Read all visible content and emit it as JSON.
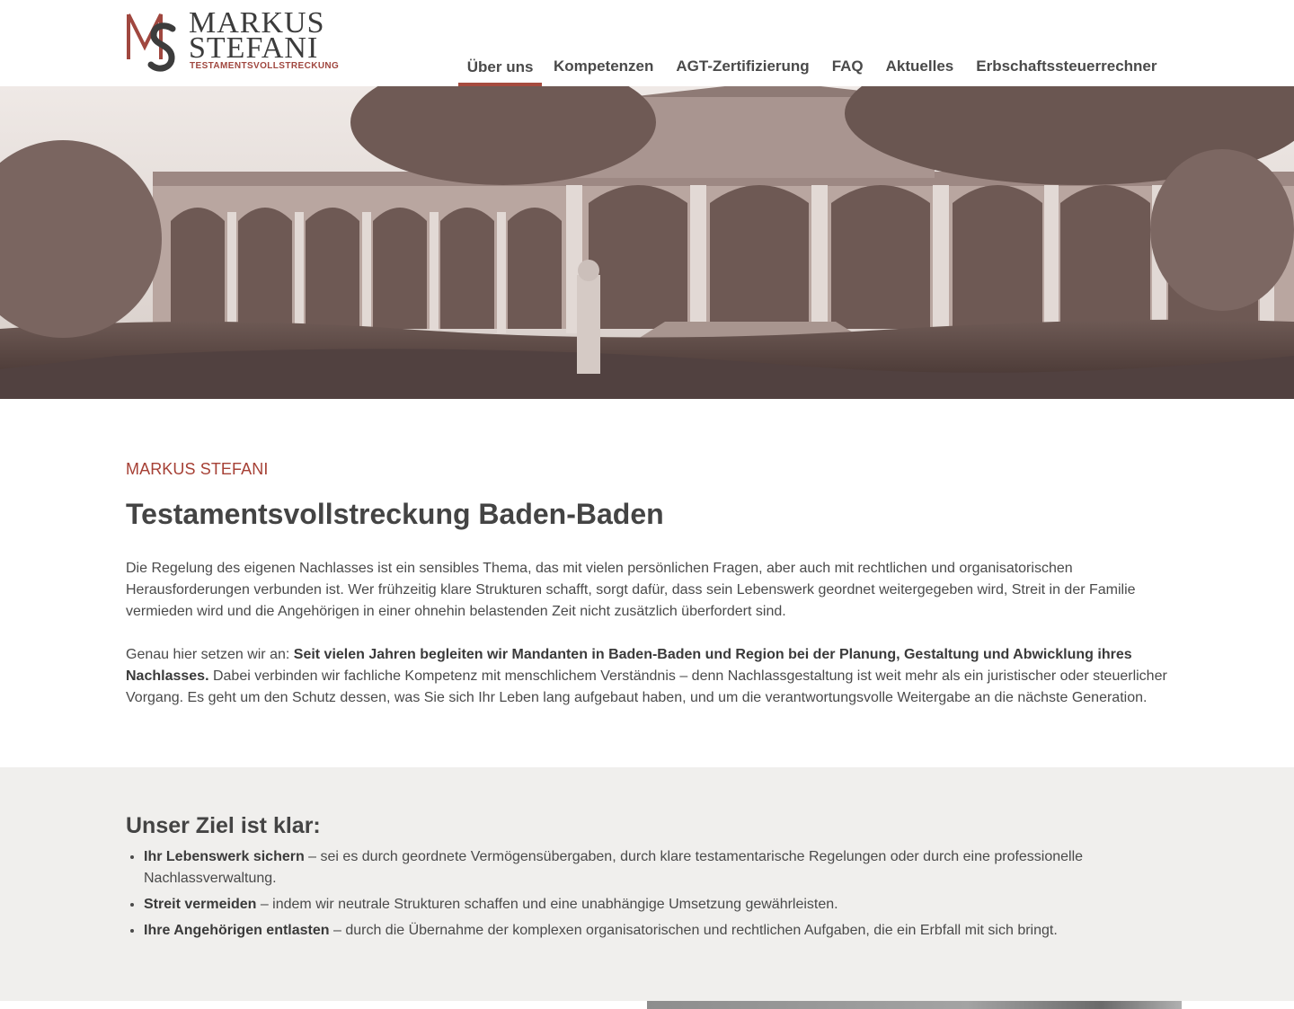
{
  "header": {
    "logo": {
      "monogram": "MS",
      "name_line1": "MARKUS",
      "name_line2": "STEFANI",
      "subtitle": "TESTAMENTSVOLLSTRECKUNG"
    },
    "nav": [
      {
        "label": "Über uns",
        "active": true
      },
      {
        "label": "Kompetenzen",
        "active": false
      },
      {
        "label": "AGT-Zertifizierung",
        "active": false
      },
      {
        "label": "FAQ",
        "active": false
      },
      {
        "label": "Aktuelles",
        "active": false
      },
      {
        "label": "Erbschaftssteuerrechner",
        "active": false
      }
    ]
  },
  "hero": {
    "image": "sepia-photo-of-colonnade-building-baden-baden"
  },
  "intro": {
    "eyebrow": "MARKUS STEFANI",
    "headline": "Testamentsvollstreckung Baden-Baden",
    "paragraph1": "Die Regelung des eigenen Nachlasses ist ein sensibles Thema, das mit vielen persönlichen Fragen, aber auch mit rechtlichen und organisatorischen Herausforderungen verbunden ist. Wer frühzeitig klare Strukturen schafft, sorgt dafür, dass sein Lebenswerk geordnet weitergegeben wird, Streit in der Familie vermieden wird und die Angehörigen in einer ohnehin belastenden Zeit nicht zusätzlich überfordert sind.",
    "paragraph2_lead": "Genau hier setzen wir an: ",
    "paragraph2_bold": "Seit vielen Jahren begleiten wir Mandanten in Baden-Baden und Region bei der Planung, Gestaltung und Abwicklung ihres Nachlasses.",
    "paragraph2_rest": " Dabei verbinden wir fachliche Kompetenz mit menschlichem Verständnis – denn Nachlassgestaltung ist weit mehr als ein juristischer oder steuerlicher Vorgang. Es geht um den Schutz dessen, was Sie sich Ihr Leben lang aufgebaut haben, und um die verantwortungsvolle Weitergabe an die nächste Generation."
  },
  "goals": {
    "title": "Unser Ziel ist klar:",
    "items": [
      {
        "bold": "Ihr Lebenswerk sichern",
        "text": " – sei es durch geordnete Vermögensübergaben, durch klare testamentarische Regelungen oder durch eine professionelle Nachlassverwaltung."
      },
      {
        "bold": "Streit vermeiden",
        "text": " – indem wir neutrale Strukturen schaffen und eine unabhängige Umsetzung gewährleisten."
      },
      {
        "bold": "Ihre Angehörigen entlasten",
        "text": " – durch die Übernahme der komplexen organisatorischen und rechtlichen Aufgaben, die ein Erbfall mit sich bringt."
      }
    ]
  },
  "colors": {
    "accent": "#a64b3f",
    "text": "#444444",
    "goals_background": "#f0efed"
  }
}
